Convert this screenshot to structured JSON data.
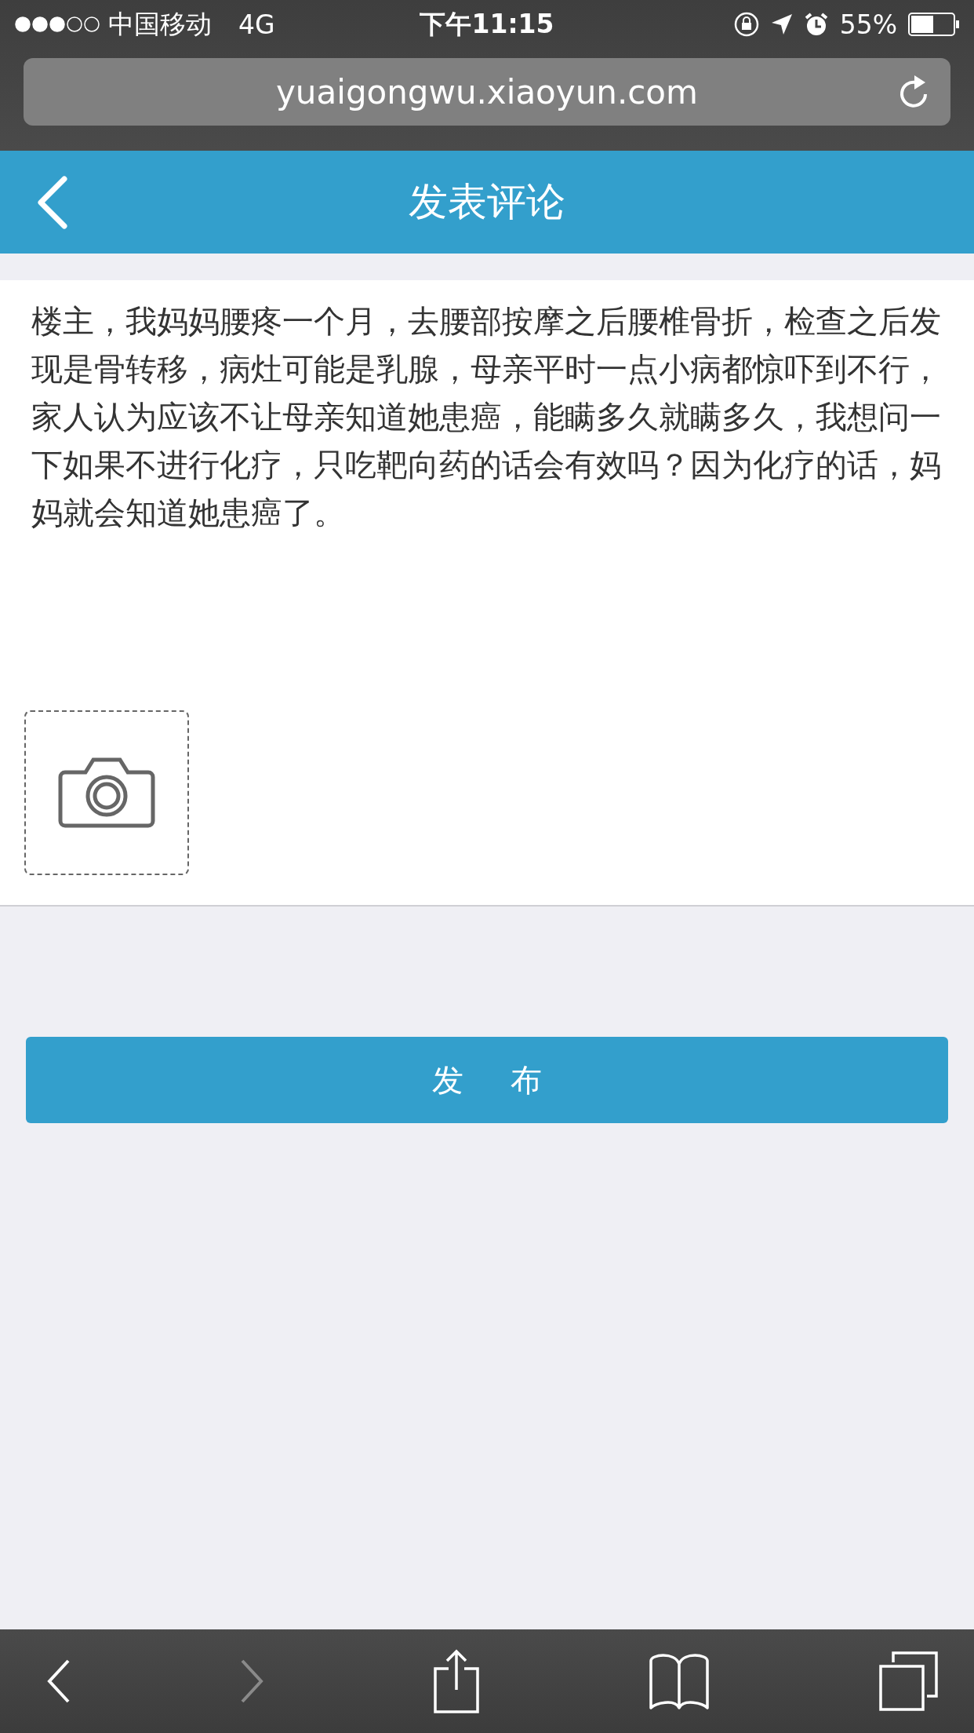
{
  "status_bar": {
    "carrier": "中国移动",
    "network": "4G",
    "time": "下午11:15",
    "battery": "55%"
  },
  "address_bar": {
    "url": "yuaigongwu.xiaoyun.com"
  },
  "nav_bar": {
    "title": "发表评论"
  },
  "comment": {
    "value": "楼主，我妈妈腰疼一个月，去腰部按摩之后腰椎骨折，检查之后发现是骨转移，病灶可能是乳腺，母亲平时一点小病都惊吓到不行，家人认为应该不让母亲知道她患癌，能瞒多久就瞒多久，我想问一下如果不进行化疗，只吃靶向药的话会有效吗？因为化疗的话，妈妈就会知道她患癌了。"
  },
  "submit_button": {
    "label": "发 布"
  },
  "toolbar": [
    {
      "kind": "back",
      "disabled": false
    },
    {
      "kind": "forward",
      "disabled": true
    },
    {
      "kind": "share",
      "disabled": false
    },
    {
      "kind": "bookmarks",
      "disabled": false
    },
    {
      "kind": "tabs",
      "disabled": false
    }
  ]
}
